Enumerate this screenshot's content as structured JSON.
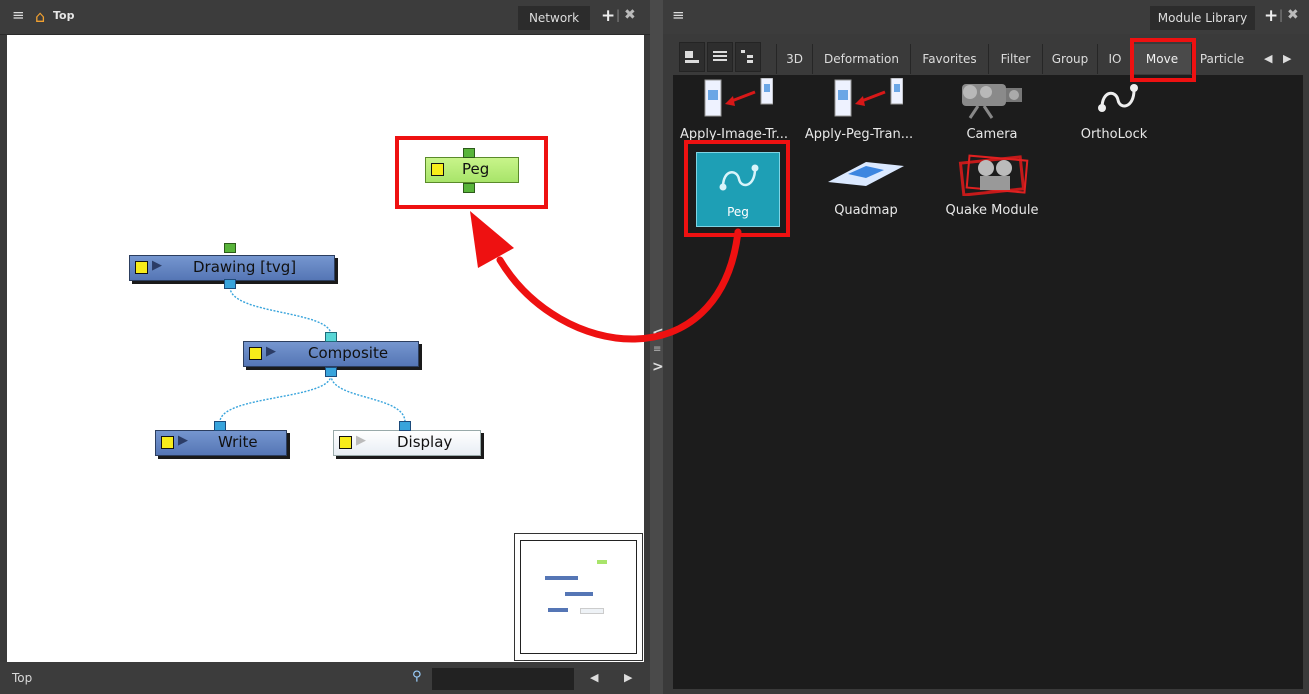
{
  "network_view": {
    "breadcrumb": "Top",
    "tab_label": "Network",
    "status_label": "Top",
    "nodes": {
      "peg": "Peg",
      "drawing": "Drawing [tvg]",
      "composite": "Composite",
      "write": "Write",
      "display": "Display"
    }
  },
  "module_library": {
    "tab_label": "Module Library",
    "categories": [
      "3D",
      "Deformation",
      "Favorites",
      "Filter",
      "Group",
      "IO",
      "Move",
      "Particle"
    ],
    "active_category": "Move",
    "modules": [
      {
        "label": "Apply-Image-Tr...",
        "icon": "apply-image-transformation-icon"
      },
      {
        "label": "Apply-Peg-Tran...",
        "icon": "apply-peg-transformation-icon"
      },
      {
        "label": "Camera",
        "icon": "camera-icon"
      },
      {
        "label": "OrthoLock",
        "icon": "ortholock-icon"
      },
      {
        "label": "Peg",
        "icon": "peg-icon",
        "selected": true
      },
      {
        "label": "Quadmap",
        "icon": "quadmap-icon"
      },
      {
        "label": "Quake Module",
        "icon": "quake-module-icon"
      }
    ]
  },
  "colors": {
    "highlight": "#ee1111",
    "node_blue": "#5576b5",
    "peg_node": "#b8f07a",
    "port_blue": "#38a4dc",
    "selected_tile": "#1e9fb5"
  }
}
